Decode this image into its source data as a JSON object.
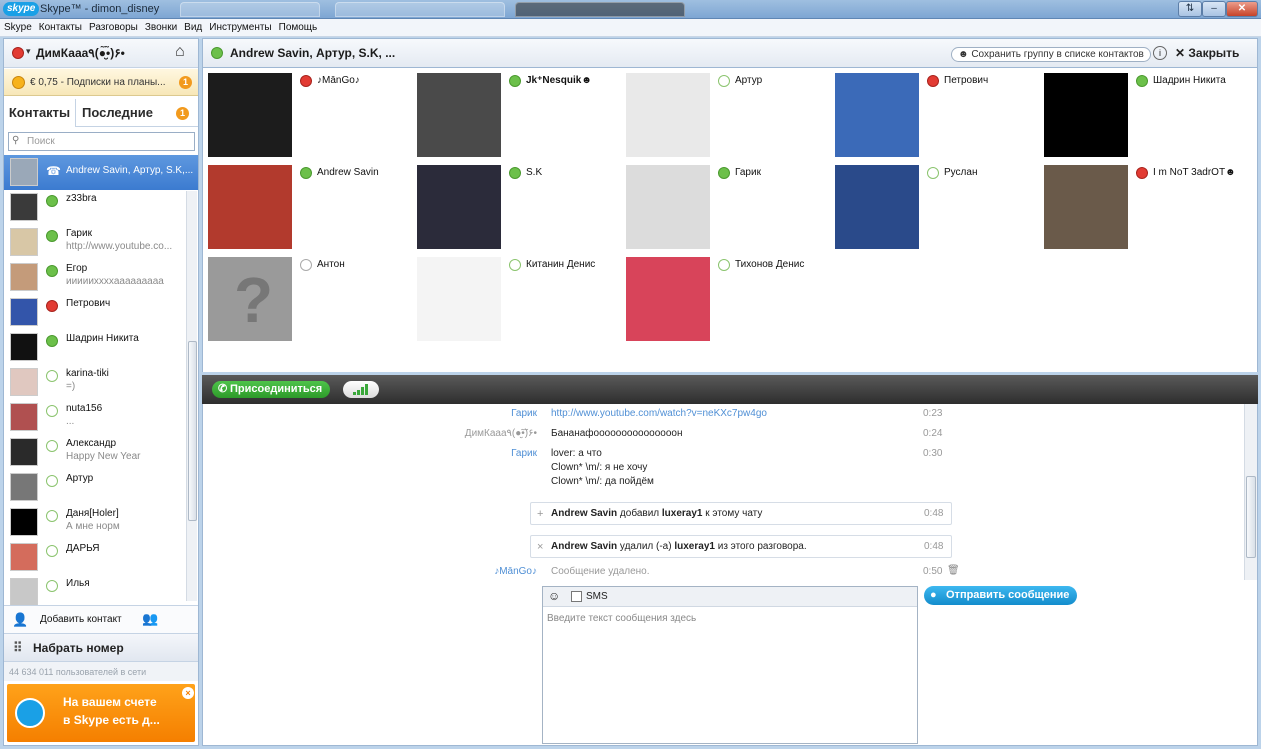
{
  "window": {
    "title": "Skype™ - dimon_disney",
    "logo": "skype"
  },
  "menu": [
    "Skype",
    "Контакты",
    "Разговоры",
    "Звонки",
    "Вид",
    "Инструменты",
    "Помощь"
  ],
  "self": {
    "name": "ДимКааа٩(●̮̮̃•̃)۶•"
  },
  "credit": {
    "text": "€ 0,75 - Подписки на планы...",
    "badge": "1"
  },
  "tabs": {
    "contacts": "Контакты",
    "recent": "Последние",
    "recent_badge": "1"
  },
  "search": {
    "placeholder": "Поиск"
  },
  "contacts": [
    {
      "name": "Andrew Savin, Артур, S.K,...",
      "sub": "",
      "status": "call",
      "selected": true
    },
    {
      "name": "z33bra",
      "sub": "",
      "status": "online"
    },
    {
      "name": "Гарик",
      "sub": "http://www.youtube.co...",
      "status": "online"
    },
    {
      "name": "Егор",
      "sub": "иииииххххааааааааа",
      "status": "online"
    },
    {
      "name": "Петрович",
      "sub": "",
      "status": "busy"
    },
    {
      "name": "Шадрин Никита",
      "sub": "",
      "status": "online"
    },
    {
      "name": "karina-tiki",
      "sub": "=)",
      "status": "offline"
    },
    {
      "name": "nuta156",
      "sub": "...",
      "status": "offline"
    },
    {
      "name": "Александр",
      "sub": "Happy New Year",
      "status": "offline"
    },
    {
      "name": "Артур",
      "sub": "",
      "status": "offline"
    },
    {
      "name": "Даня[Holer]",
      "sub": "А мне норм",
      "status": "offline"
    },
    {
      "name": "ДАРЬЯ",
      "sub": "",
      "status": "offline"
    },
    {
      "name": "Илья",
      "sub": "",
      "status": "offline"
    }
  ],
  "add_contact": "Добавить контакт",
  "dial": "Набрать номер",
  "online_count": "44 634 011 пользователей в сети",
  "promo": {
    "line1": "На вашем счете",
    "line2": "в Skype есть д..."
  },
  "conversation": {
    "title": "Andrew Savin, Артур, S.K, ...",
    "save_group": "Сохранить группу в списке контактов",
    "close": "Закрыть"
  },
  "participants": [
    {
      "name": "♪MānGo♪",
      "status": "busy"
    },
    {
      "name": "Jk⁺Nesquik☻",
      "status": "online"
    },
    {
      "name": "Артур",
      "status": "offline"
    },
    {
      "name": "Петрович",
      "status": "busy"
    },
    {
      "name": "Шадрин Никита",
      "status": "online"
    },
    {
      "name": "Andrew Savin",
      "status": "online"
    },
    {
      "name": "S.K",
      "status": "online"
    },
    {
      "name": "Гарик",
      "status": "online"
    },
    {
      "name": "Руслан",
      "status": "offline"
    },
    {
      "name": "I m NoT 3adrOT☻",
      "status": "busy"
    },
    {
      "name": "Антон",
      "status": "unknown"
    },
    {
      "name": "Китанин Денис",
      "status": "offline"
    },
    {
      "name": "Тихонов Денис",
      "status": "offline"
    }
  ],
  "call": {
    "join": "Присоединиться"
  },
  "messages": [
    {
      "author": "Гарик",
      "lines": [
        "http://www.youtube.com/watch?v=neKXc7pw4go"
      ],
      "time": "0:23"
    },
    {
      "author": "ДимКааа٩(●̮̮̃•̃)۶•",
      "lines": [
        "Бананафооооооооооооооон"
      ],
      "time": "0:24"
    },
    {
      "author": "Гарик",
      "lines": [
        "lover: а что",
        "Clown* \\m/: я не хочу",
        "Clown* \\m/: да пойдём"
      ],
      "time": "0:30"
    }
  ],
  "system_messages": [
    {
      "icon": "+",
      "actor": "Andrew Savin",
      "action": "добавил",
      "target": "luxeray1",
      "rest": "к этому чату",
      "time": "0:48"
    },
    {
      "icon": "×",
      "actor": "Andrew Savin",
      "action": "удалил (-а)",
      "target": "luxeray1",
      "rest": "из этого разговора.",
      "time": "0:48"
    }
  ],
  "deleted": {
    "author": "♪MānGo♪",
    "text": "Сообщение удалено.",
    "time": "0:50"
  },
  "composer": {
    "sms": "SMS",
    "placeholder": "Введите текст сообщения здесь",
    "send": "Отправить сообщение"
  }
}
